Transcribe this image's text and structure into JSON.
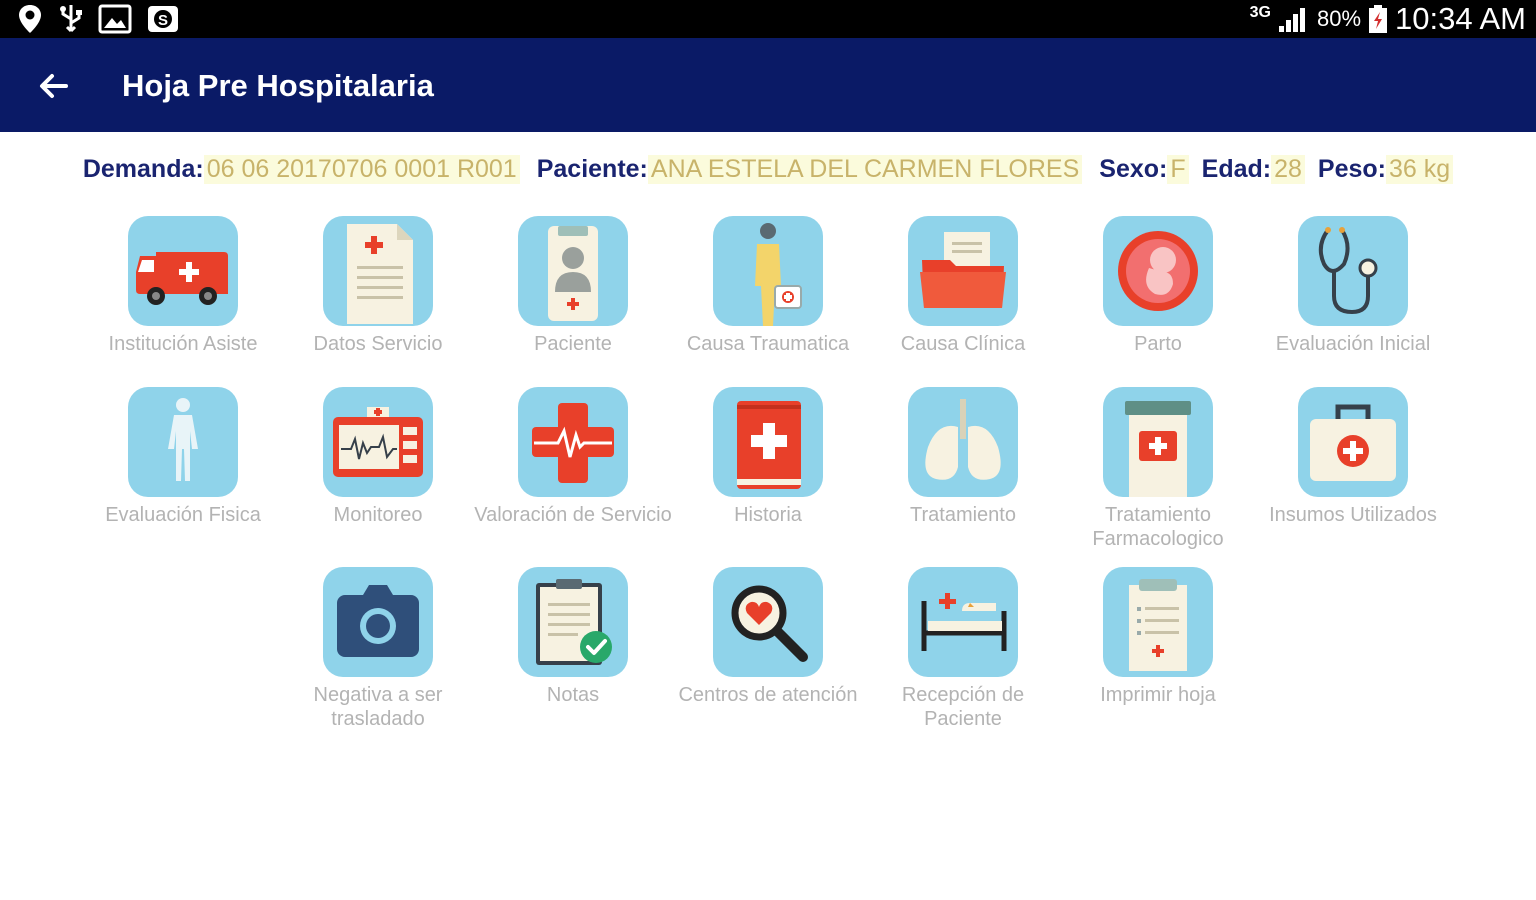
{
  "statusbar": {
    "network": "3G",
    "battery": "80%",
    "time": "10:34 AM"
  },
  "appbar": {
    "title": "Hoja Pre Hospitalaria"
  },
  "info": {
    "demanda_label": "Demanda:",
    "demanda_value": "06 06 20170706 0001 R001",
    "paciente_label": "Paciente:",
    "paciente_value": "ANA ESTELA DEL CARMEN FLORES",
    "sexo_label": "Sexo:",
    "sexo_value": "F",
    "edad_label": "Edad:",
    "edad_value": "28",
    "peso_label": "Peso:",
    "peso_value": "36 kg"
  },
  "tiles": [
    {
      "label": "Institución Asiste",
      "icon": "ambulance-icon"
    },
    {
      "label": "Datos Servicio",
      "icon": "document-icon"
    },
    {
      "label": "Paciente",
      "icon": "patient-badge-icon"
    },
    {
      "label": "Causa Traumatica",
      "icon": "injured-person-icon"
    },
    {
      "label": "Causa Clínica",
      "icon": "folder-icon"
    },
    {
      "label": "Parto",
      "icon": "fetus-icon"
    },
    {
      "label": "Evaluación Inicial",
      "icon": "stethoscope-icon"
    },
    {
      "label": "Evaluación Fisica",
      "icon": "human-body-icon"
    },
    {
      "label": "Monitoreo",
      "icon": "heart-monitor-icon"
    },
    {
      "label": "Valoración de Servicio",
      "icon": "medical-cross-icon"
    },
    {
      "label": "Historia",
      "icon": "medical-book-icon"
    },
    {
      "label": "Tratamiento",
      "icon": "lungs-icon"
    },
    {
      "label": "Tratamiento Farmacologico",
      "icon": "medicine-jar-icon"
    },
    {
      "label": "Insumos Utilizados",
      "icon": "first-aid-kit-icon"
    },
    {
      "label": "Negativa a ser trasladado",
      "icon": "camera-icon"
    },
    {
      "label": "Notas",
      "icon": "clipboard-check-icon"
    },
    {
      "label": "Centros de atención",
      "icon": "magnifier-heart-icon"
    },
    {
      "label": "Recepción de Paciente",
      "icon": "hospital-bed-icon"
    },
    {
      "label": "Imprimir hoja",
      "icon": "clipboard-list-icon"
    }
  ]
}
